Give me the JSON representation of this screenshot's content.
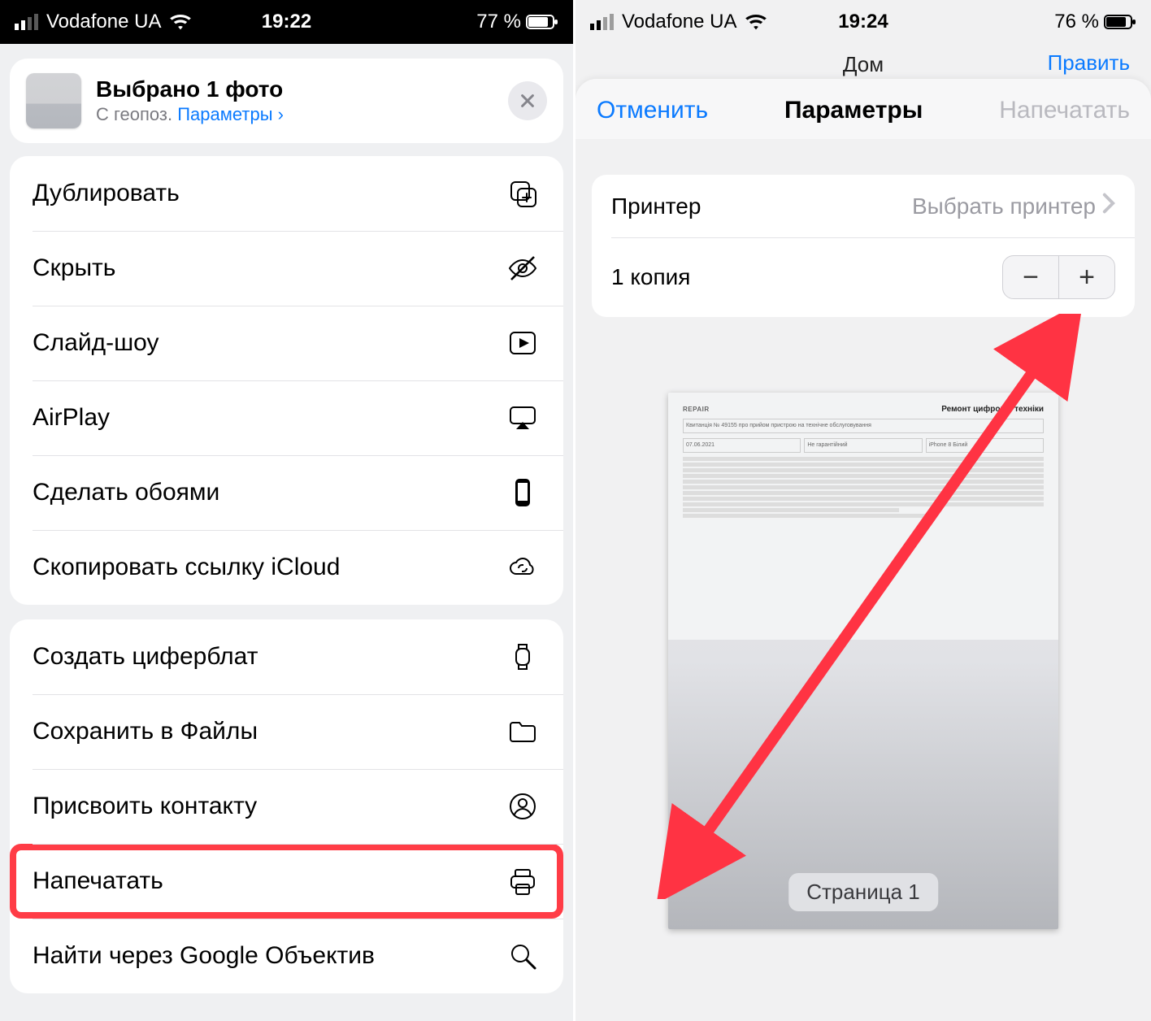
{
  "left": {
    "status": {
      "carrier": "Vodafone UA",
      "time": "19:22",
      "battery": "77 %"
    },
    "header": {
      "title": "Выбрано 1 фото",
      "subtitle_prefix": "С геопоз.  ",
      "subtitle_link": "Параметры ›"
    },
    "group1": [
      {
        "label": "Дублировать",
        "icon": "duplicate"
      },
      {
        "label": "Скрыть",
        "icon": "hide"
      },
      {
        "label": "Слайд-шоу",
        "icon": "slideshow"
      },
      {
        "label": "AirPlay",
        "icon": "airplay"
      },
      {
        "label": "Сделать обоями",
        "icon": "wallpaper"
      },
      {
        "label": "Скопировать ссылку iCloud",
        "icon": "icloud-link"
      }
    ],
    "group2": [
      {
        "label": "Создать циферблат",
        "icon": "watchface"
      },
      {
        "label": "Сохранить в Файлы",
        "icon": "folder"
      },
      {
        "label": "Присвоить контакту",
        "icon": "contact"
      },
      {
        "label": "Напечатать",
        "icon": "print",
        "highlight": true
      },
      {
        "label": "Найти через Google Объектив",
        "icon": "search"
      }
    ]
  },
  "right": {
    "status": {
      "carrier": "Vodafone UA",
      "time": "19:24",
      "battery": "76 %"
    },
    "behind_title": "Дом",
    "behind_edit": "Править",
    "nav": {
      "cancel": "Отменить",
      "title": "Параметры",
      "print": "Напечатать"
    },
    "printer_row": {
      "label": "Принтер",
      "value": "Выбрать принтер"
    },
    "copies_row": {
      "label": "1 копия"
    },
    "page_badge": "Страница 1",
    "doc": {
      "logo": "REPAIR",
      "title": "Ремонт цифрової техніки",
      "receipt": "Квитанція № 49155 про прийом пристрою на технічне обслуговування",
      "date": "07.06.2021",
      "type": "Не гарантійний",
      "model": "iPhone 8 Білий"
    }
  }
}
